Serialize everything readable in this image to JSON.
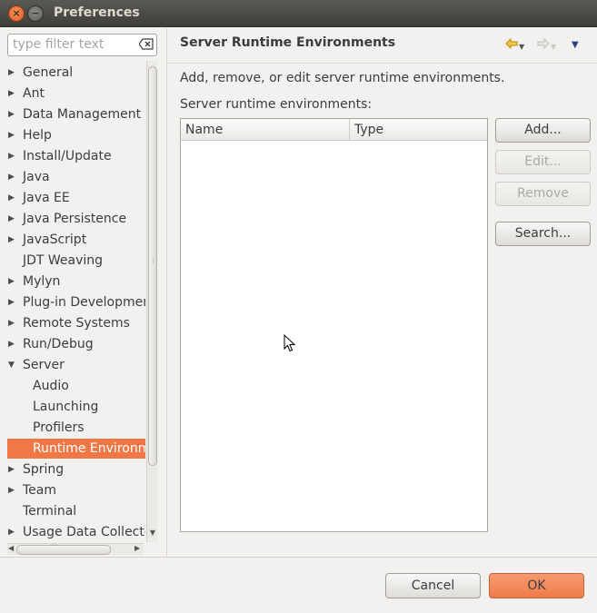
{
  "window": {
    "title": "Preferences",
    "close_glyph": "×",
    "minimize_glyph": "−"
  },
  "filter": {
    "placeholder": "type filter text",
    "clear_icon": "clear-filter-icon"
  },
  "tree": {
    "items": [
      {
        "label": "General",
        "expandable": true,
        "expanded": false,
        "level": 0,
        "selected": false
      },
      {
        "label": "Ant",
        "expandable": true,
        "expanded": false,
        "level": 0,
        "selected": false
      },
      {
        "label": "Data Management",
        "expandable": true,
        "expanded": false,
        "level": 0,
        "selected": false
      },
      {
        "label": "Help",
        "expandable": true,
        "expanded": false,
        "level": 0,
        "selected": false
      },
      {
        "label": "Install/Update",
        "expandable": true,
        "expanded": false,
        "level": 0,
        "selected": false
      },
      {
        "label": "Java",
        "expandable": true,
        "expanded": false,
        "level": 0,
        "selected": false
      },
      {
        "label": "Java EE",
        "expandable": true,
        "expanded": false,
        "level": 0,
        "selected": false
      },
      {
        "label": "Java Persistence",
        "expandable": true,
        "expanded": false,
        "level": 0,
        "selected": false
      },
      {
        "label": "JavaScript",
        "expandable": true,
        "expanded": false,
        "level": 0,
        "selected": false
      },
      {
        "label": "JDT Weaving",
        "expandable": false,
        "expanded": false,
        "level": 0,
        "selected": false
      },
      {
        "label": "Mylyn",
        "expandable": true,
        "expanded": false,
        "level": 0,
        "selected": false
      },
      {
        "label": "Plug-in Developmen",
        "expandable": true,
        "expanded": false,
        "level": 0,
        "selected": false
      },
      {
        "label": "Remote Systems",
        "expandable": true,
        "expanded": false,
        "level": 0,
        "selected": false
      },
      {
        "label": "Run/Debug",
        "expandable": true,
        "expanded": false,
        "level": 0,
        "selected": false
      },
      {
        "label": "Server",
        "expandable": true,
        "expanded": true,
        "level": 0,
        "selected": false
      },
      {
        "label": "Audio",
        "expandable": false,
        "expanded": false,
        "level": 1,
        "selected": false
      },
      {
        "label": "Launching",
        "expandable": false,
        "expanded": false,
        "level": 1,
        "selected": false
      },
      {
        "label": "Profilers",
        "expandable": false,
        "expanded": false,
        "level": 1,
        "selected": false
      },
      {
        "label": "Runtime Environm",
        "expandable": false,
        "expanded": false,
        "level": 1,
        "selected": true
      },
      {
        "label": "Spring",
        "expandable": true,
        "expanded": false,
        "level": 0,
        "selected": false
      },
      {
        "label": "Team",
        "expandable": true,
        "expanded": false,
        "level": 0,
        "selected": false
      },
      {
        "label": "Terminal",
        "expandable": false,
        "expanded": false,
        "level": 0,
        "selected": false
      },
      {
        "label": "Usage Data Collecto",
        "expandable": true,
        "expanded": false,
        "level": 0,
        "selected": false
      }
    ],
    "selection_color": "#f07746"
  },
  "page": {
    "heading": "Server Runtime Environments",
    "description": "Add, remove, or edit server runtime environments.",
    "list_label": "Server runtime environments:",
    "nav_back_icon": "back-arrow-icon",
    "nav_forward_icon": "forward-arrow-icon",
    "nav_menu_icon": "view-menu-icon"
  },
  "table": {
    "columns": [
      "Name",
      "Type"
    ],
    "rows": []
  },
  "buttons": {
    "add": "Add...",
    "edit": "Edit...",
    "remove": "Remove",
    "search": "Search..."
  },
  "footer": {
    "cancel": "Cancel",
    "ok": "OK"
  },
  "colors": {
    "accent": "#f07746",
    "titlebar": "#4b4a46"
  }
}
